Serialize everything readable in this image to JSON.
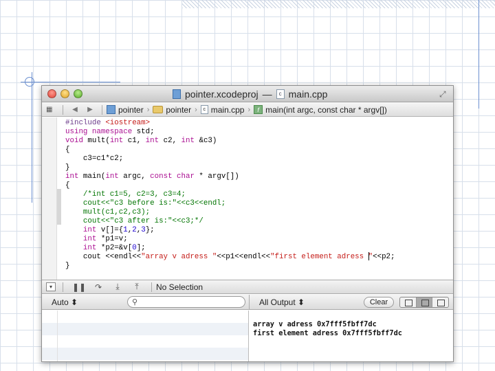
{
  "window": {
    "title_project": "pointer.xcodeproj",
    "title_sep": "—",
    "title_file": "main.cpp"
  },
  "jumpbar": {
    "crumbs": [
      "pointer",
      "pointer",
      "main.cpp",
      "main(int argc, const char * argv[])"
    ]
  },
  "editor": {
    "lines": [
      [
        [
          "#include ",
          "#6b3b8a"
        ],
        [
          "<iostream>",
          "#c41a16"
        ]
      ],
      [
        [
          "using namespace",
          "#aa0d91"
        ],
        [
          " std;",
          "#000000"
        ]
      ],
      [
        [
          "void",
          "#aa0d91"
        ],
        [
          " mult(",
          "#000000"
        ],
        [
          "int",
          "#aa0d91"
        ],
        [
          " c1, ",
          "#000000"
        ],
        [
          "int",
          "#aa0d91"
        ],
        [
          " c2, ",
          "#000000"
        ],
        [
          "int",
          "#aa0d91"
        ],
        [
          " &c3)",
          "#000000"
        ]
      ],
      [
        [
          "{",
          "#000000"
        ]
      ],
      [
        [
          "    c3=c1*c2;",
          "#000000"
        ]
      ],
      [
        [
          "}",
          "#000000"
        ]
      ],
      [
        [
          "int",
          "#aa0d91"
        ],
        [
          " main(",
          "#000000"
        ],
        [
          "int",
          "#aa0d91"
        ],
        [
          " argc, ",
          "#000000"
        ],
        [
          "const char",
          "#aa0d91"
        ],
        [
          " * argv[])",
          "#000000"
        ]
      ],
      [
        [
          "{",
          "#000000"
        ]
      ],
      [
        [
          "    /*int c1=5, c2=3, c3=4;",
          "#007400"
        ]
      ],
      [
        [
          "    cout<<\"c3 before is:\"<<c3<<endl;",
          "#007400"
        ]
      ],
      [
        [
          "    mult(c1,c2,c3);",
          "#007400"
        ]
      ],
      [
        [
          "    cout<<\"c3 after is:\"<<c3;*/",
          "#007400"
        ]
      ],
      [
        [
          "    ",
          "#000000"
        ],
        [
          "int",
          "#aa0d91"
        ],
        [
          " v[]={",
          "#000000"
        ],
        [
          "1",
          "#1c00cf"
        ],
        [
          ",",
          "#000000"
        ],
        [
          "2",
          "#1c00cf"
        ],
        [
          ",",
          "#000000"
        ],
        [
          "3",
          "#1c00cf"
        ],
        [
          "};",
          "#000000"
        ]
      ],
      [
        [
          "    ",
          "#000000"
        ],
        [
          "int",
          "#aa0d91"
        ],
        [
          " *p1=v;",
          "#000000"
        ]
      ],
      [
        [
          "    ",
          "#000000"
        ],
        [
          "int",
          "#aa0d91"
        ],
        [
          " *p2=&v[",
          "#000000"
        ],
        [
          "0",
          "#1c00cf"
        ],
        [
          "];",
          "#000000"
        ]
      ],
      [
        [
          "    cout <<endl<<",
          "#000000"
        ],
        [
          "\"array v adress \"",
          "#c41a16"
        ],
        [
          "<<p1<<endl<<",
          "#000000"
        ],
        [
          "\"first element adress \"",
          "#c41a16"
        ],
        [
          "<<p2;",
          "#000000"
        ]
      ],
      [
        [
          "}",
          "#000000"
        ]
      ]
    ]
  },
  "debugbar": {
    "selection": "No Selection"
  },
  "consolebar": {
    "scope": "Auto ⬍",
    "output_filter": "All Output ⬍",
    "clear_label": "Clear"
  },
  "console": {
    "output": "array v adress 0x7fff5fbff7dc\nfirst element adress 0x7fff5fbff7dc"
  },
  "icons": {
    "close": "close-icon",
    "minimize": "minimize-icon",
    "zoom": "zoom-icon",
    "back": "chevron-left-icon",
    "forward": "chevron-right-icon",
    "search": "search-icon"
  }
}
